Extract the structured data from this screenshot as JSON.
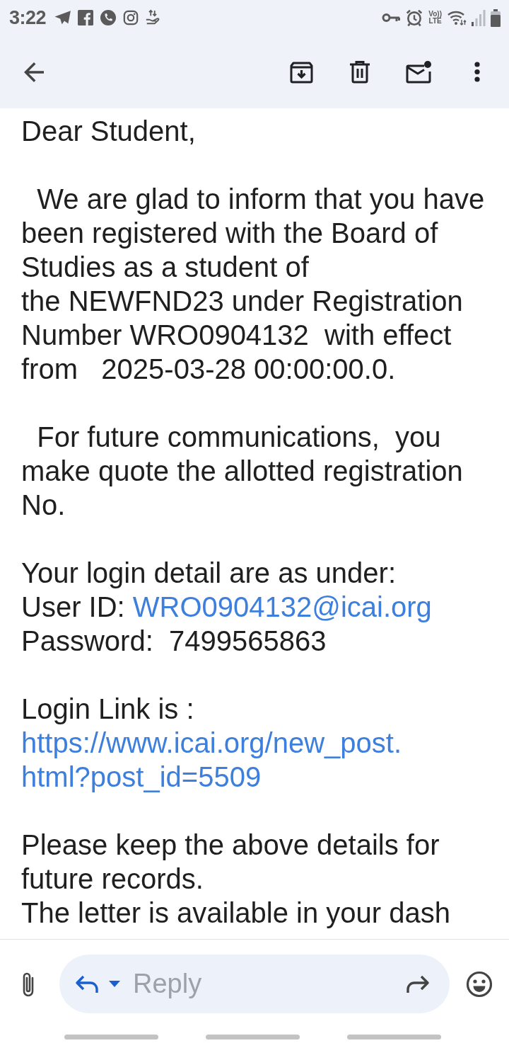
{
  "status_bar": {
    "time": "3:22",
    "volte": {
      "top": "Vo))",
      "bottom": "LTE"
    }
  },
  "message": {
    "sections": [
      {
        "lines": [
          {
            "kind": "text",
            "text": "Dear Student,"
          }
        ]
      },
      {
        "lines": [
          {
            "kind": "text",
            "text": "  We are glad to inform that you have been registered with the Board of Studies as a student of\nthe NEWFND23 under Registration Number WRO0904132  with effect from   2025-03-28 00:00:00.0."
          }
        ]
      },
      {
        "lines": [
          {
            "kind": "text",
            "text": "  For future communications,  you make quote the allotted registration No."
          }
        ]
      },
      {
        "lines": [
          {
            "kind": "text",
            "text": "Your login detail are as under:"
          },
          {
            "kind": "labeled_link",
            "label": "User ID: ",
            "link": "WRO0904132@icai.org"
          },
          {
            "kind": "text",
            "text": "Password:  7499565863"
          }
        ]
      },
      {
        "lines": [
          {
            "kind": "text",
            "text": "Login Link is :"
          },
          {
            "kind": "link",
            "text": "https://www.icai.org/new_post.html?post_id=5509"
          }
        ]
      },
      {
        "lines": [
          {
            "kind": "text",
            "text": "Please keep the above details for future records."
          },
          {
            "kind": "text",
            "text": "The letter is available in your dash"
          }
        ]
      }
    ]
  },
  "reply_bar": {
    "placeholder": "Reply"
  }
}
